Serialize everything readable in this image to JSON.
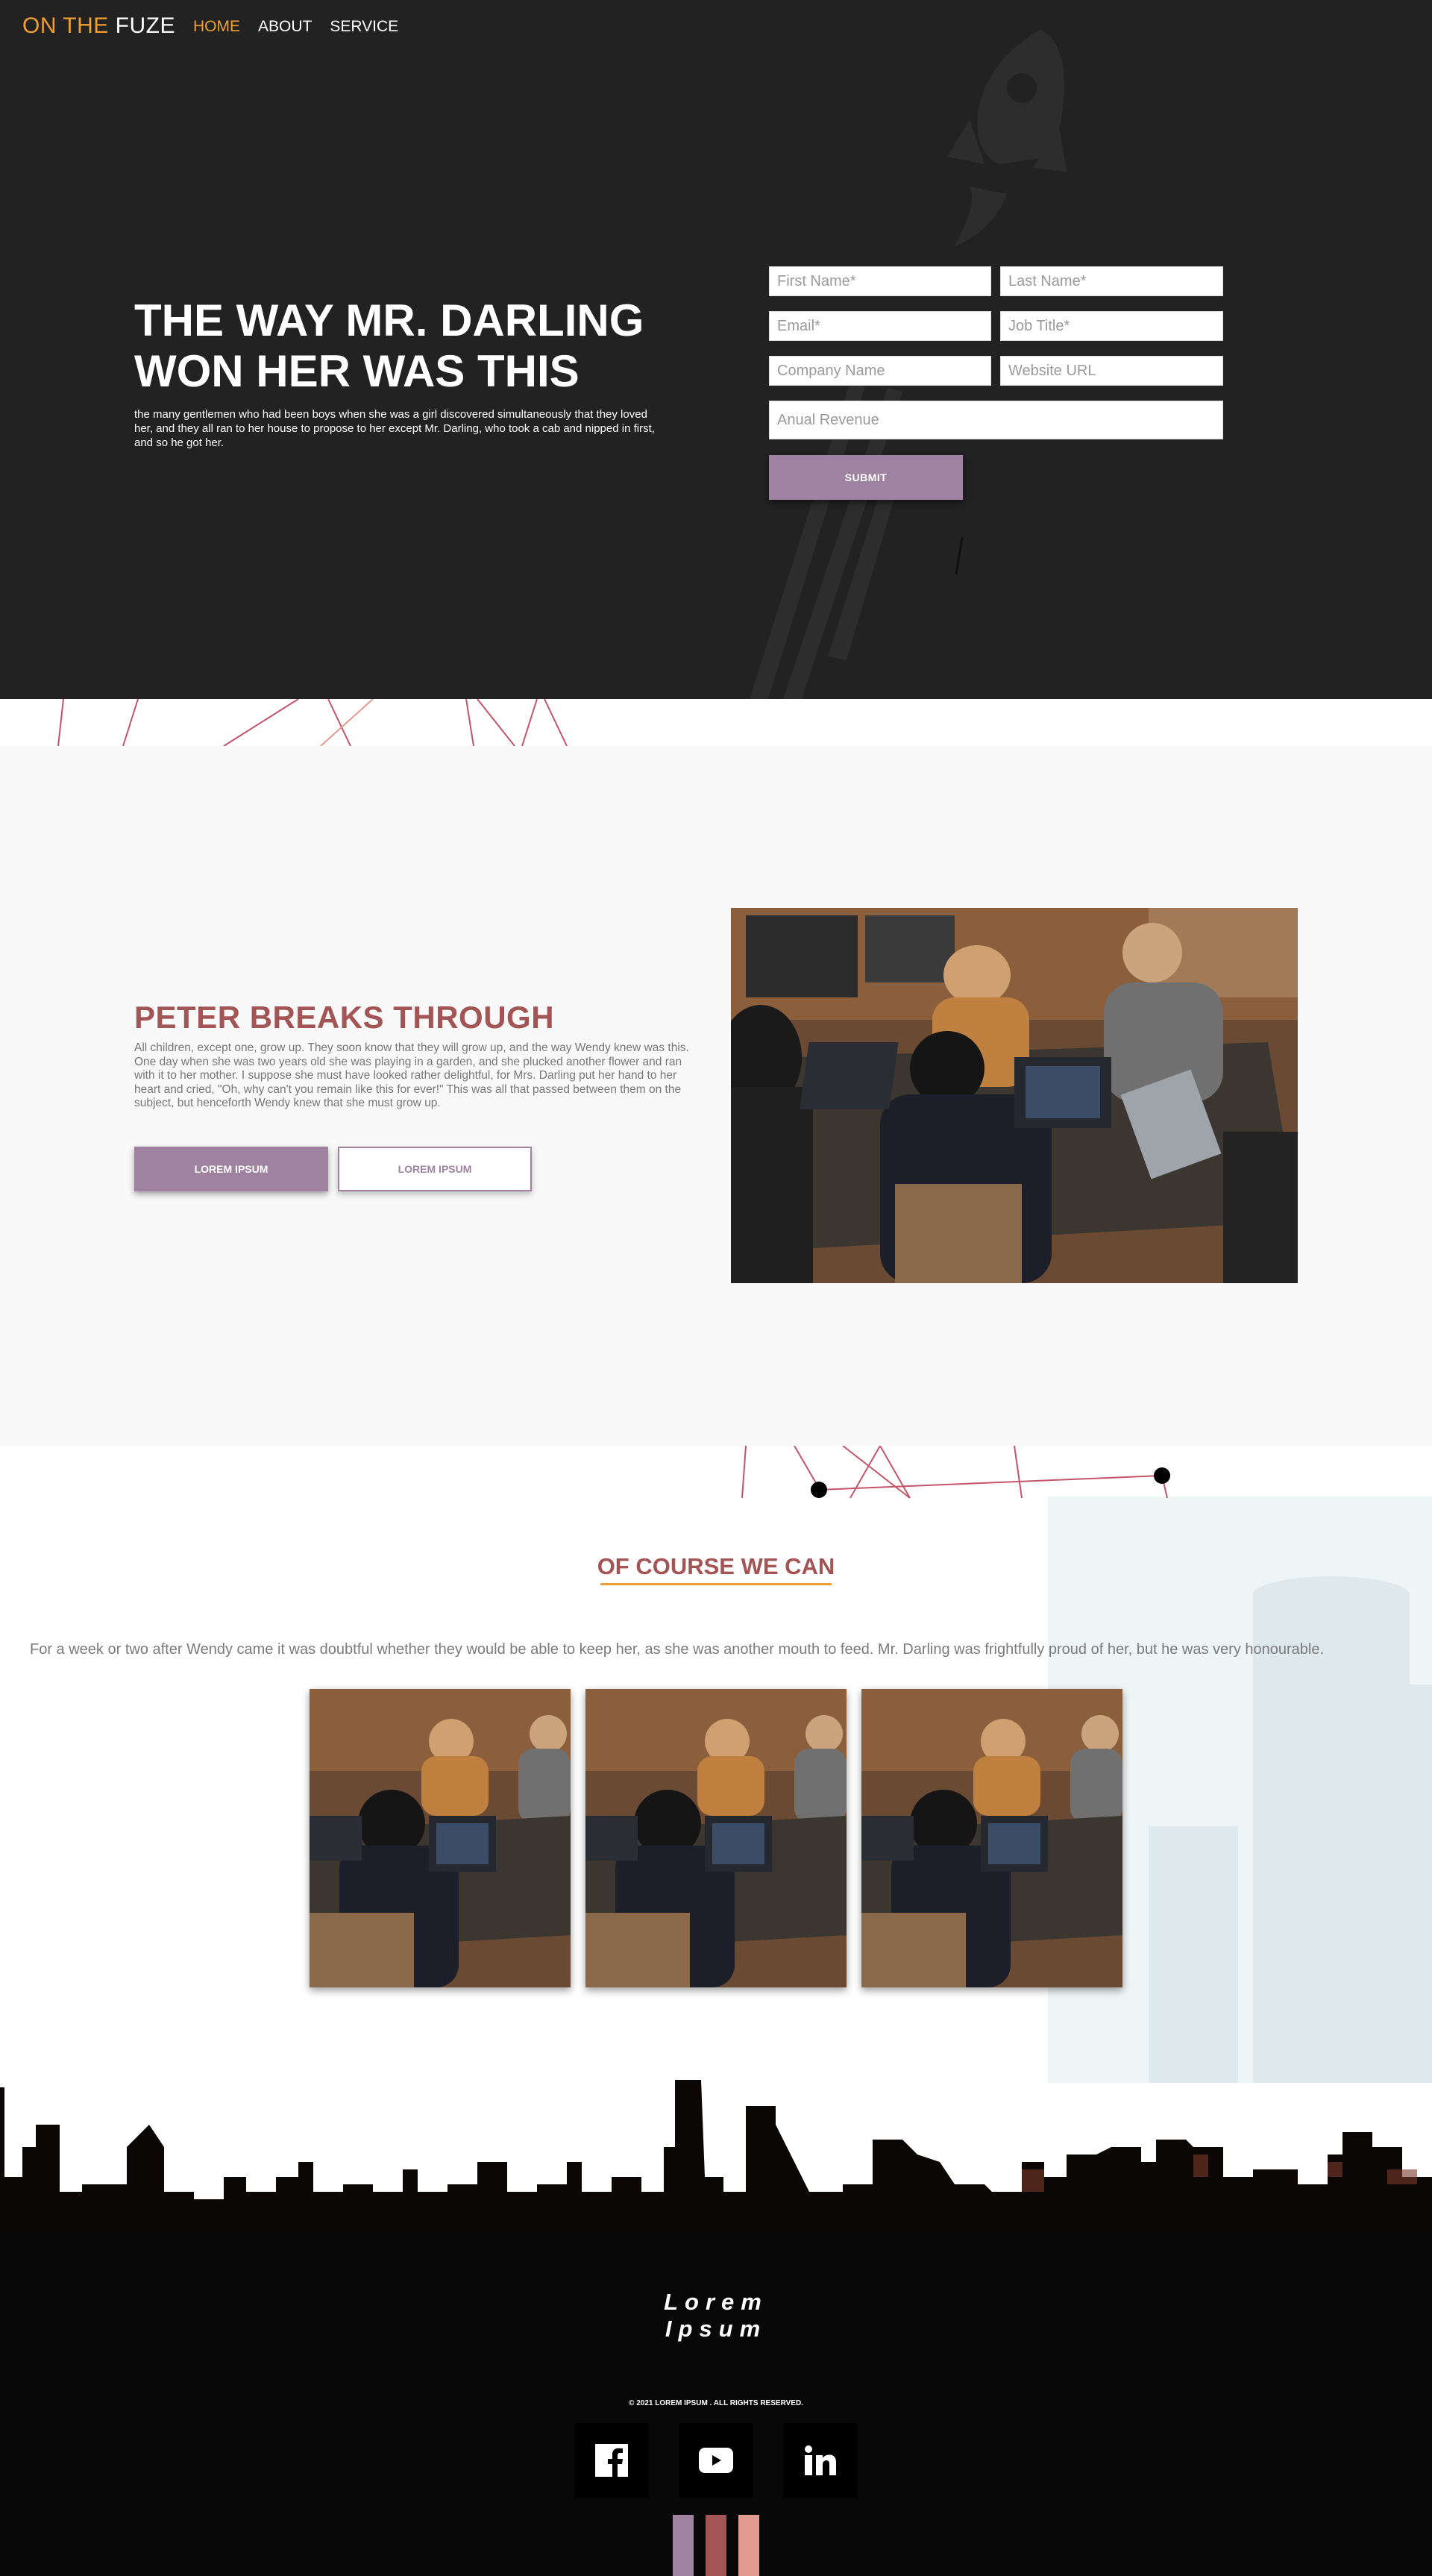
{
  "header": {
    "brand_part1": "ON THE",
    "brand_part2": "FUZE",
    "nav": [
      {
        "label": "HOME",
        "active": true
      },
      {
        "label": "ABOUT",
        "active": false
      },
      {
        "label": "SERVICE",
        "active": false
      }
    ]
  },
  "hero": {
    "title_line1": "THE WAY MR. DARLING",
    "title_line2": "WON HER WAS THIS",
    "text": "the many gentlemen who had been boys when she was a girl discovered simultaneously that they loved her, and they all ran to her house to propose to her except Mr. Darling, who took a cab and nipped in first, and so he got her.",
    "form": {
      "first_name_placeholder": "First Name*",
      "last_name_placeholder": "Last Name*",
      "email_placeholder": "Email*",
      "job_title_placeholder": "Job Title*",
      "company_placeholder": "Company Name",
      "website_placeholder": "Website URL",
      "revenue_placeholder": "Anual Revenue",
      "submit_label": "SUBMIT"
    }
  },
  "section2": {
    "title": "PETER BREAKS THROUGH",
    "text": "All children, except one, grow up. They soon know that they will grow up, and the way Wendy knew was this. One day when she was two years old she was playing in a garden, and she plucked another flower and ran with it to her mother. I suppose she must have looked rather delightful, for Mrs. Darling put her hand to her heart and cried, \"Oh, why can't you remain like this for ever!\" This was all that passed between them on the subject, but henceforth Wendy knew that she must grow up.",
    "primary_button": "LOREM IPSUM",
    "secondary_button": "LOREM IPSUM"
  },
  "section3": {
    "title": "OF COURSE WE CAN",
    "text": "For a week or two after Wendy came it was doubtful whether they would be able to keep her, as she was another mouth to feed. Mr. Darling was frightfully proud of her, but he was very honourable."
  },
  "footer": {
    "logo_line1": "Lorem",
    "logo_line2": "Ipsum",
    "copyright": "© 2021 LOREM IPSUM . ALL RIGHTS RESERVED.",
    "social": [
      "facebook-icon",
      "youtube-icon",
      "linkedin-icon"
    ],
    "swatches": [
      "#9e829f",
      "#a35455",
      "#e39a90"
    ]
  },
  "colors": {
    "accent": "#f0a030",
    "primary": "#9e829f",
    "heading": "#a35455",
    "hero_bg": "#222222",
    "footer_bg": "#080808"
  }
}
